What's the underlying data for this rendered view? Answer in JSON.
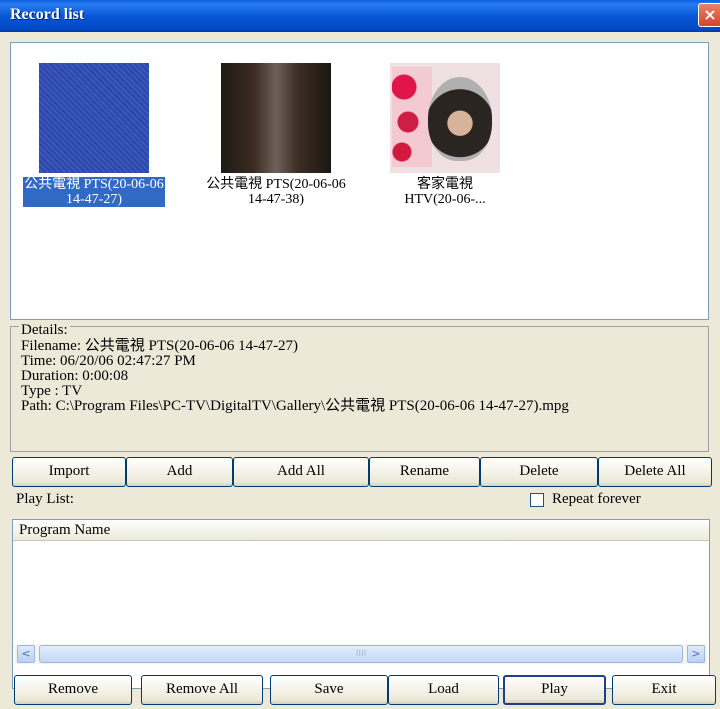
{
  "window": {
    "title": "Record list",
    "close_glyph": "×"
  },
  "thumbnails": [
    {
      "caption_line1": "公共電視 PTS(20-06-06",
      "caption_line2": "14-47-27)",
      "selected": true
    },
    {
      "caption_line1": "公共電視 PTS(20-06-06",
      "caption_line2": "14-47-38)",
      "selected": false
    },
    {
      "caption_line1": "客家電視",
      "caption_line2": "HTV(20-06-...",
      "selected": false
    }
  ],
  "details": {
    "legend": "Details:",
    "filename": "Filename: 公共電視 PTS(20-06-06 14-47-27)",
    "time": "Time: 06/20/06 02:47:27 PM",
    "duration": "Duration: 0:00:08",
    "type": "Type : TV",
    "path": "Path: C:\\Program Files\\PC-TV\\DigitalTV\\Gallery\\公共電視 PTS(20-06-06 14-47-27).mpg"
  },
  "top_buttons": {
    "import": "Import",
    "add": "Add",
    "add_all": "Add All",
    "rename": "Rename",
    "delete": "Delete",
    "delete_all": "Delete All"
  },
  "playlist": {
    "label": "Play List:",
    "repeat_label": "Repeat forever",
    "repeat_checked": false,
    "column_header": "Program Name",
    "scroll_left": "<",
    "scroll_right": ">",
    "scroll_grip": "IIII"
  },
  "bottom_buttons": {
    "remove": "Remove",
    "remove_all": "Remove All",
    "save": "Save",
    "load": "Load",
    "play": "Play",
    "exit": "Exit"
  }
}
